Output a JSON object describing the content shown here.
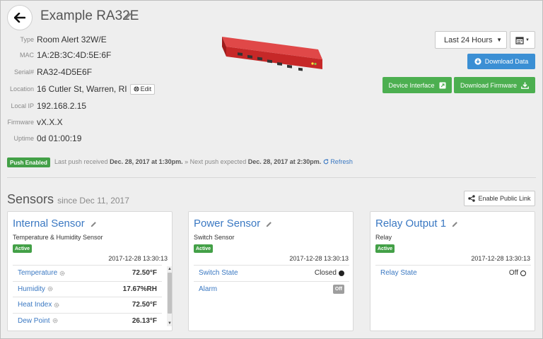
{
  "header": {
    "title": "Example RA32E"
  },
  "info": [
    {
      "label": "Type",
      "value": "Room Alert 32W/E"
    },
    {
      "label": "MAC",
      "value": "1A:2B:3C:4D:5E:6F"
    },
    {
      "label": "Serial#",
      "value": "RA32-4D5E6F"
    },
    {
      "label": "Location",
      "value": "16 Cutler St, Warren, RI"
    },
    {
      "label": "Local IP",
      "value": "192.168.2.15"
    },
    {
      "label": "Firmware",
      "value": "vX.X.X"
    },
    {
      "label": "Uptime",
      "value": "0d 01:00:19"
    }
  ],
  "location_edit_label": "Edit",
  "controls": {
    "range": "Last 24 Hours",
    "download_data": "Download Data",
    "device_interface": "Device Interface",
    "download_firmware": "Download Firmware"
  },
  "push": {
    "badge": "Push Enabled",
    "last_prefix": "Last push received",
    "last_time": "Dec. 28, 2017 at 1:30pm.",
    "next_prefix": "» Next push expected",
    "next_time": "Dec. 28, 2017 at 2:30pm.",
    "refresh": "Refresh"
  },
  "sensors": {
    "title": "Sensors",
    "since": "since Dec 11, 2017",
    "public_link": "Enable Public Link",
    "cards": [
      {
        "title": "Internal Sensor",
        "type": "Temperature & Humidity Sensor",
        "badge": "Active",
        "time": "2017-12-28 13:30:13",
        "rows": [
          {
            "label": "Temperature",
            "value": "72.50°F"
          },
          {
            "label": "Humidity",
            "value": "17.67%RH"
          },
          {
            "label": "Heat Index",
            "value": "72.50°F"
          },
          {
            "label": "Dew Point",
            "value": "26.13°F"
          }
        ]
      },
      {
        "title": "Power Sensor",
        "type": "Switch Sensor",
        "badge": "Active",
        "time": "2017-12-28 13:30:13",
        "rows": [
          {
            "label": "Switch State",
            "value": "Closed"
          },
          {
            "label": "Alarm",
            "value": "Off"
          }
        ]
      },
      {
        "title": "Relay Output 1",
        "type": "Relay",
        "badge": "Active",
        "time": "2017-12-28 13:30:13",
        "rows": [
          {
            "label": "Relay State",
            "value": "Off"
          }
        ]
      }
    ]
  },
  "colors": {
    "link_blue": "#3a78c2",
    "button_blue": "#3b8fd4",
    "button_green": "#4caf50",
    "active_green": "#43a047"
  },
  "icons": {
    "back": "arrow-left-icon",
    "edit": "pencil-icon",
    "calendar": "calendar-icon",
    "download": "download-icon",
    "external": "external-link-icon",
    "share": "share-icon",
    "refresh": "refresh-icon",
    "gear": "gear-icon",
    "globe": "globe-icon"
  }
}
